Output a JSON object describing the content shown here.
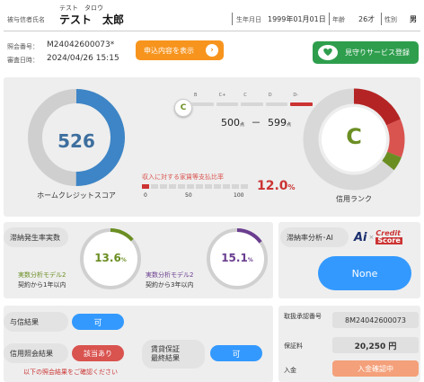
{
  "header": {
    "name_label": "被与信者氏名",
    "furigana": "テスト　タロウ",
    "name": "テスト　太郎",
    "birth_label": "生年月日",
    "birth_value": "1999年01月01日",
    "age_label": "年齢",
    "age_value": "26才",
    "gender_label": "性別",
    "gender_value": "男"
  },
  "inquiry": {
    "number_label": "照会番号：",
    "number_value": "M24042600073*",
    "datetime_label": "審査日時：",
    "datetime_value": "2024/04/26 15:15",
    "show_button": "申込内容を表示",
    "service_button": "見守りサービス登録"
  },
  "score": {
    "value": "526",
    "label": "ホームクレジットスコア",
    "fraction": 0.5
  },
  "rank": {
    "letters": [
      "C",
      "B",
      "C+",
      "C",
      "D",
      "D-"
    ],
    "current": "C",
    "range_low": "500",
    "range_high": "599",
    "range_sep": "－",
    "unit": "点",
    "label": "信用ランク",
    "big": "C"
  },
  "ratio": {
    "label": "収入に対する家賃等支払比率",
    "ticks": [
      "0",
      "50",
      "100"
    ],
    "value": "12.0",
    "unit": "%"
  },
  "delinquency": {
    "label": "滞納発生率実数",
    "analysis_label": "滞納率分析･AI",
    "left_value": "13.6",
    "left_unit": "%",
    "left_model": "実数分析モデル2",
    "left_period": "契約から1年以内",
    "left_fraction": 0.136,
    "right_value": "15.1",
    "right_unit": "%",
    "right_model": "実数分析モデル2",
    "right_period": "契約から3年以内",
    "right_fraction": 0.151,
    "ai_result": "None",
    "logo_ai": "Ai",
    "logo_cross": "×",
    "logo_credit": "Credit",
    "logo_score": "Score"
  },
  "results": {
    "credit_label": "与信結果",
    "credit_value": "可",
    "inquiry_label": "信用照会結果",
    "inquiry_value": "該当あり",
    "note": "以下の照会結果をご確認ください",
    "guarantee_label": "賃貸保証\n最終結果",
    "guarantee_value": "可"
  },
  "details": {
    "approval_label": "取扱承認番号",
    "approval_value": "8M24042600073",
    "fee_label": "保証料",
    "fee_value": "20,250 円",
    "payment_label": "入金",
    "payment_value": "入金確認中"
  },
  "colors": {
    "blue": "#3d85c6",
    "orange": "#f7941d",
    "green": "#2e9e4d",
    "red": "#cc3333",
    "olive": "#6b8e23",
    "purple": "#6a3d8f",
    "pill_blue": "#3399ff"
  }
}
